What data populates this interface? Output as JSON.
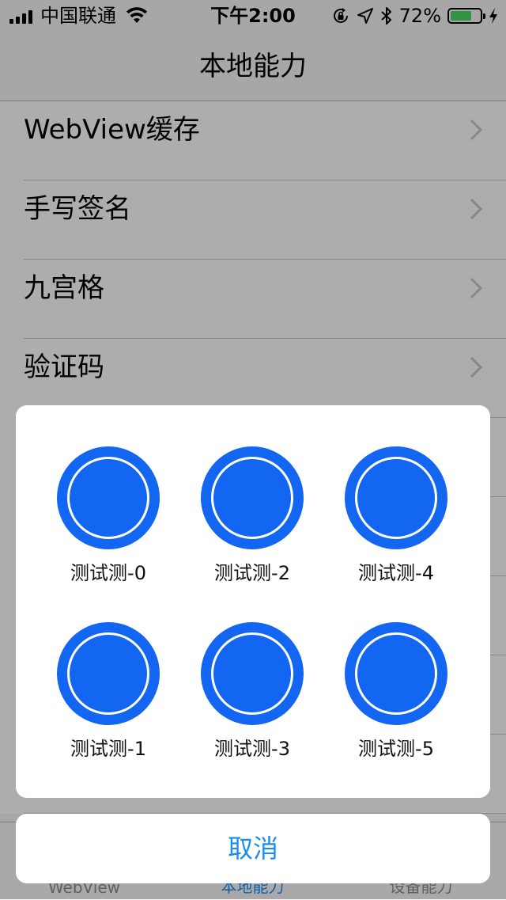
{
  "status_bar": {
    "carrier": "中国联通",
    "time": "下午2:00",
    "battery_percent": "72%",
    "battery_level": 0.72,
    "battery_color": "#4cd964",
    "icons": [
      "signal-icon",
      "wifi-icon",
      "orientation-lock-icon",
      "location-icon",
      "bluetooth-icon",
      "battery-icon",
      "charging-icon"
    ]
  },
  "nav": {
    "title": "本地能力"
  },
  "list": {
    "items": [
      {
        "label": "WebView缓存"
      },
      {
        "label": "手写签名"
      },
      {
        "label": "九宫格"
      },
      {
        "label": "验证码"
      }
    ]
  },
  "sheet": {
    "accent_color": "#1266f1",
    "items": [
      {
        "label": "测试测-0"
      },
      {
        "label": "测试测-2"
      },
      {
        "label": "测试测-4"
      },
      {
        "label": "测试测-1"
      },
      {
        "label": "测试测-3"
      },
      {
        "label": "测试测-5"
      }
    ],
    "cancel_label": "取消"
  },
  "tabs": [
    {
      "label": "WebView",
      "active": false
    },
    {
      "label": "本地能力",
      "active": true
    },
    {
      "label": "设备能力",
      "active": false
    }
  ],
  "colors": {
    "accent": "#1a8cf0",
    "overlay": "rgba(0,0,0,0.32)"
  }
}
